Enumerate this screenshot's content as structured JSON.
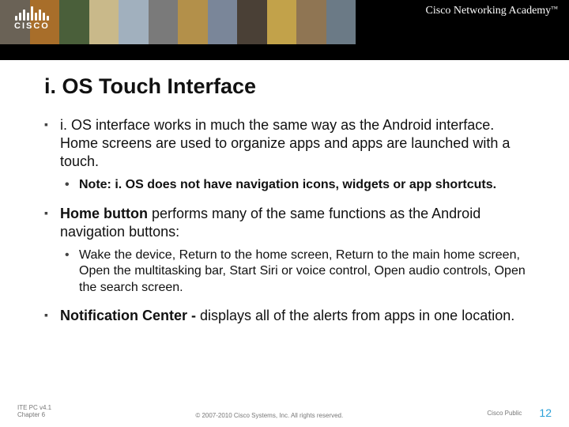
{
  "brand": {
    "name": "CISCO",
    "academy": "Cisco Networking Academy",
    "tm": "™"
  },
  "banner_bars": [
    "#6a6256",
    "#a86e2a",
    "#4a5f3a",
    "#c9b98a",
    "#a1b0be",
    "#7a7a7a",
    "#b3904a",
    "#7a8699",
    "#4a4036",
    "#c2a24a",
    "#8f7553",
    "#6b7a86"
  ],
  "title": "i. OS Touch Interface",
  "p1": "i. OS interface works in much the same way as the Android interface. Home screens are used to organize apps and apps are launched with a touch.",
  "note_label": "Note:",
  "note_body_pre": " i. OS does ",
  "note_not": "not",
  "note_body_post": " have navigation icons, widgets or app shortcuts.",
  "p2_bold": "Home button",
  "p2_rest": " performs many of the same functions as the Android navigation buttons:",
  "p2_sub": "Wake the device, Return to the home screen, Return to the main home screen, Open the multitasking bar, Start Siri or voice control, Open audio controls, Open the search screen.",
  "p3_bold": "Notification Center - ",
  "p3_rest": " displays all of the alerts from apps in one location.",
  "footer": {
    "left_l1": "ITE PC v4.1",
    "left_l2": "Chapter 6",
    "mid": "© 2007-2010 Cisco Systems, Inc. All rights reserved.",
    "public": "Cisco Public",
    "page": "12"
  }
}
